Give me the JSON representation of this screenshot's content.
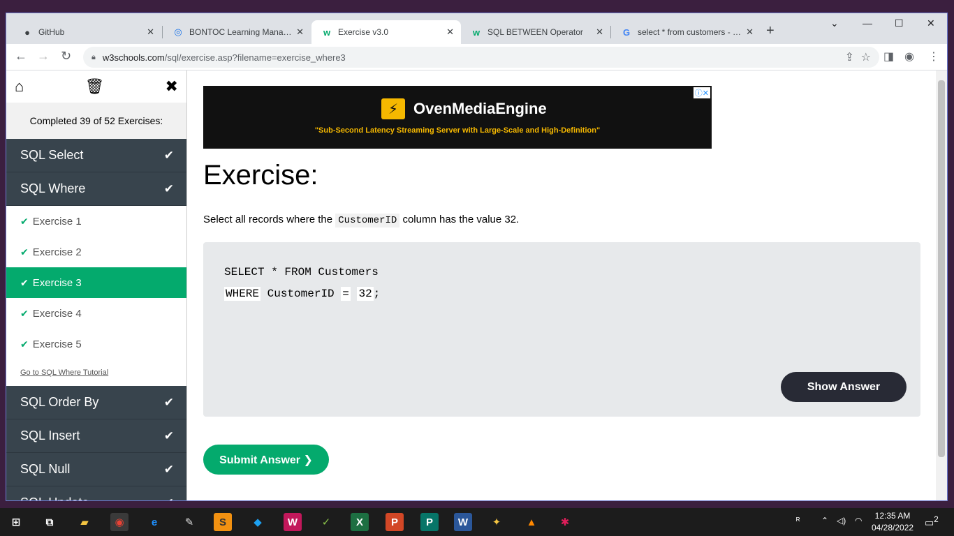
{
  "browser": {
    "tabs": [
      {
        "title": "GitHub",
        "icon": "github-icon"
      },
      {
        "title": "BONTOC Learning Managem",
        "icon": "globe-icon"
      },
      {
        "title": "Exercise v3.0",
        "icon": "w3schools-icon"
      },
      {
        "title": "SQL BETWEEN Operator",
        "icon": "w3schools-icon"
      },
      {
        "title": "select * from customers - Go",
        "icon": "google-icon"
      }
    ],
    "active_tab": 2,
    "url_host": "w3schools.com",
    "url_path": "/sql/exercise.asp?filename=exercise_where3"
  },
  "sidebar": {
    "completed_text": "Completed 39 of 52 Exercises:",
    "sections_before": [
      {
        "label": "SQL Select"
      },
      {
        "label": "SQL Where"
      }
    ],
    "exercises": [
      {
        "label": "Exercise 1"
      },
      {
        "label": "Exercise 2"
      },
      {
        "label": "Exercise 3"
      },
      {
        "label": "Exercise 4"
      },
      {
        "label": "Exercise 5"
      }
    ],
    "active_exercise": 2,
    "tutorial_link": "Go to SQL Where Tutorial",
    "sections_after": [
      {
        "label": "SQL Order By"
      },
      {
        "label": "SQL Insert"
      },
      {
        "label": "SQL Null"
      },
      {
        "label": "SQL Update"
      }
    ]
  },
  "ad": {
    "brand": "OvenMediaEngine",
    "tagline": "\"Sub-Second Latency Streaming Server with Large-Scale and High-Definition\""
  },
  "exercise": {
    "heading": "Exercise:",
    "instr_before": "Select all records where the",
    "instr_code": "CustomerID",
    "instr_after": "column has the value 32.",
    "code_line1": "SELECT * FROM Customers",
    "fill1": "WHERE",
    "code_mid": "CustomerID",
    "fill2": "=",
    "fill3": "32",
    "code_end": ";",
    "show_answer": "Show Answer",
    "submit": "Submit Answer ❯"
  },
  "taskbar": {
    "time": "12:35 AM",
    "date": "04/28/2022",
    "notifications": "2"
  },
  "colors": {
    "accent_green": "#04aa6d",
    "sidebar_dark": "#38444d",
    "button_dark": "#282a35"
  }
}
